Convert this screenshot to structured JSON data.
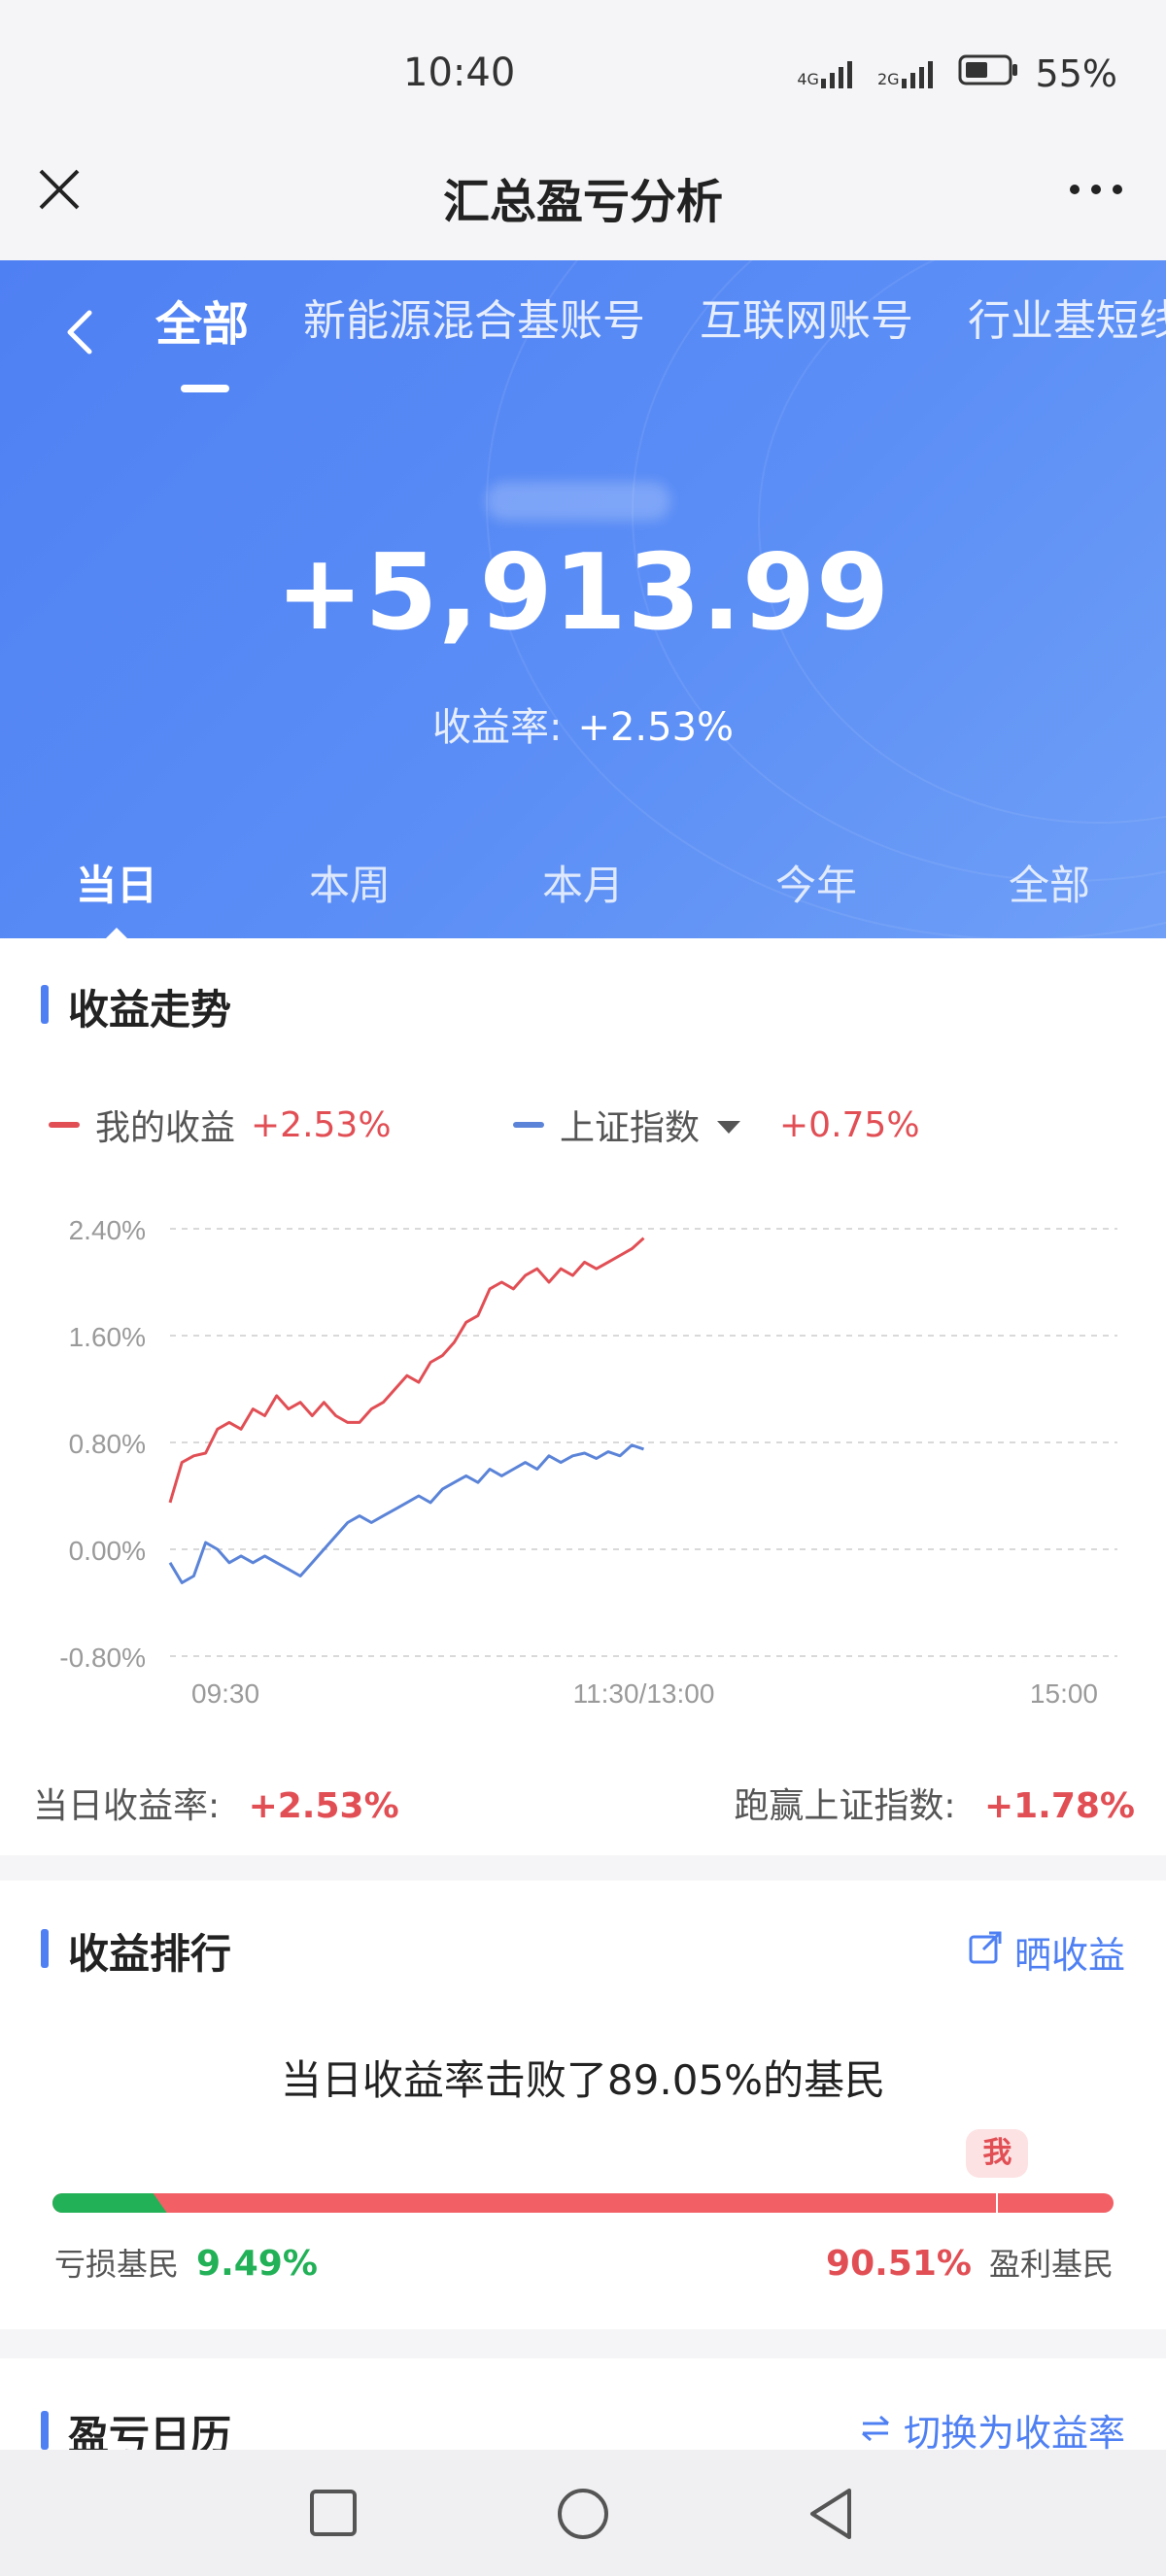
{
  "status_bar": {
    "time": "10:40",
    "signal1": "4G",
    "signal2": "2G",
    "battery": "55%"
  },
  "nav": {
    "title": "汇总盈亏分析"
  },
  "accounts": [
    {
      "label": "全部",
      "active": true
    },
    {
      "label": "新能源混合基账号",
      "active": false
    },
    {
      "label": "互联网账号",
      "active": false
    },
    {
      "label": "行业基短线",
      "active": false
    }
  ],
  "hero": {
    "amount": "+5,913.99",
    "rate_label": "收益率:",
    "rate_value": "+2.53%"
  },
  "periods": [
    {
      "label": "当日",
      "active": true
    },
    {
      "label": "本周",
      "active": false
    },
    {
      "label": "本月",
      "active": false
    },
    {
      "label": "今年",
      "active": false
    },
    {
      "label": "全部",
      "active": false
    }
  ],
  "trend": {
    "title": "收益走势",
    "legend": [
      {
        "name": "我的收益",
        "value": "+2.53%",
        "color": "#e14f55"
      },
      {
        "name": "上证指数",
        "value": "+0.75%",
        "color": "#5b84d8"
      }
    ],
    "summary_left_label": "当日收益率:",
    "summary_left_value": "+2.53%",
    "summary_right_label": "跑赢上证指数:",
    "summary_right_value": "+1.78%"
  },
  "chart_data": {
    "type": "line",
    "y_ticks": [
      "2.40%",
      "1.60%",
      "0.80%",
      "0.00%",
      "-0.80%"
    ],
    "x_ticks": [
      "09:30",
      "11:30/13:00",
      "15:00"
    ],
    "ylim": [
      -0.8,
      2.4
    ],
    "xlim": [
      0,
      240
    ],
    "series": [
      {
        "name": "我的收益",
        "color": "#e14f55",
        "x": [
          0,
          3,
          6,
          9,
          12,
          15,
          18,
          21,
          24,
          27,
          30,
          33,
          36,
          39,
          42,
          45,
          48,
          51,
          54,
          57,
          60,
          63,
          66,
          69,
          72,
          75,
          78,
          81,
          84,
          87,
          90,
          93,
          96,
          99,
          102,
          105,
          108,
          111,
          114,
          117,
          120
        ],
        "values": [
          0.35,
          0.65,
          0.7,
          0.72,
          0.9,
          0.95,
          0.9,
          1.05,
          1.0,
          1.15,
          1.05,
          1.1,
          1.0,
          1.1,
          1.0,
          0.95,
          0.95,
          1.05,
          1.1,
          1.2,
          1.3,
          1.25,
          1.4,
          1.45,
          1.55,
          1.7,
          1.75,
          1.95,
          2.0,
          1.95,
          2.05,
          2.1,
          2.0,
          2.1,
          2.05,
          2.15,
          2.1,
          2.15,
          2.2,
          2.25,
          2.33
        ]
      },
      {
        "name": "上证指数",
        "color": "#5b84d8",
        "x": [
          0,
          3,
          6,
          9,
          12,
          15,
          18,
          21,
          24,
          27,
          30,
          33,
          36,
          39,
          42,
          45,
          48,
          51,
          54,
          57,
          60,
          63,
          66,
          69,
          72,
          75,
          78,
          81,
          84,
          87,
          90,
          93,
          96,
          99,
          102,
          105,
          108,
          111,
          114,
          117,
          120
        ],
        "values": [
          -0.1,
          -0.25,
          -0.2,
          0.05,
          0.0,
          -0.1,
          -0.05,
          -0.1,
          -0.05,
          -0.1,
          -0.15,
          -0.2,
          -0.1,
          0.0,
          0.1,
          0.2,
          0.25,
          0.2,
          0.25,
          0.3,
          0.35,
          0.4,
          0.35,
          0.45,
          0.5,
          0.55,
          0.5,
          0.6,
          0.55,
          0.6,
          0.65,
          0.6,
          0.7,
          0.65,
          0.7,
          0.72,
          0.68,
          0.73,
          0.7,
          0.78,
          0.75
        ]
      }
    ]
  },
  "ranking": {
    "title": "收益排行",
    "share_label": "晒收益",
    "headline": "当日收益率击败了89.05%的基民",
    "lose_label": "亏损基民",
    "lose_value": "9.49%",
    "lose_fraction": 0.0949,
    "win_value": "90.51%",
    "win_label": "盈利基民",
    "me_label": "我",
    "me_fraction": 0.8905
  },
  "calendar": {
    "title": "盈亏日历",
    "switch_label": "切换为收益率"
  }
}
